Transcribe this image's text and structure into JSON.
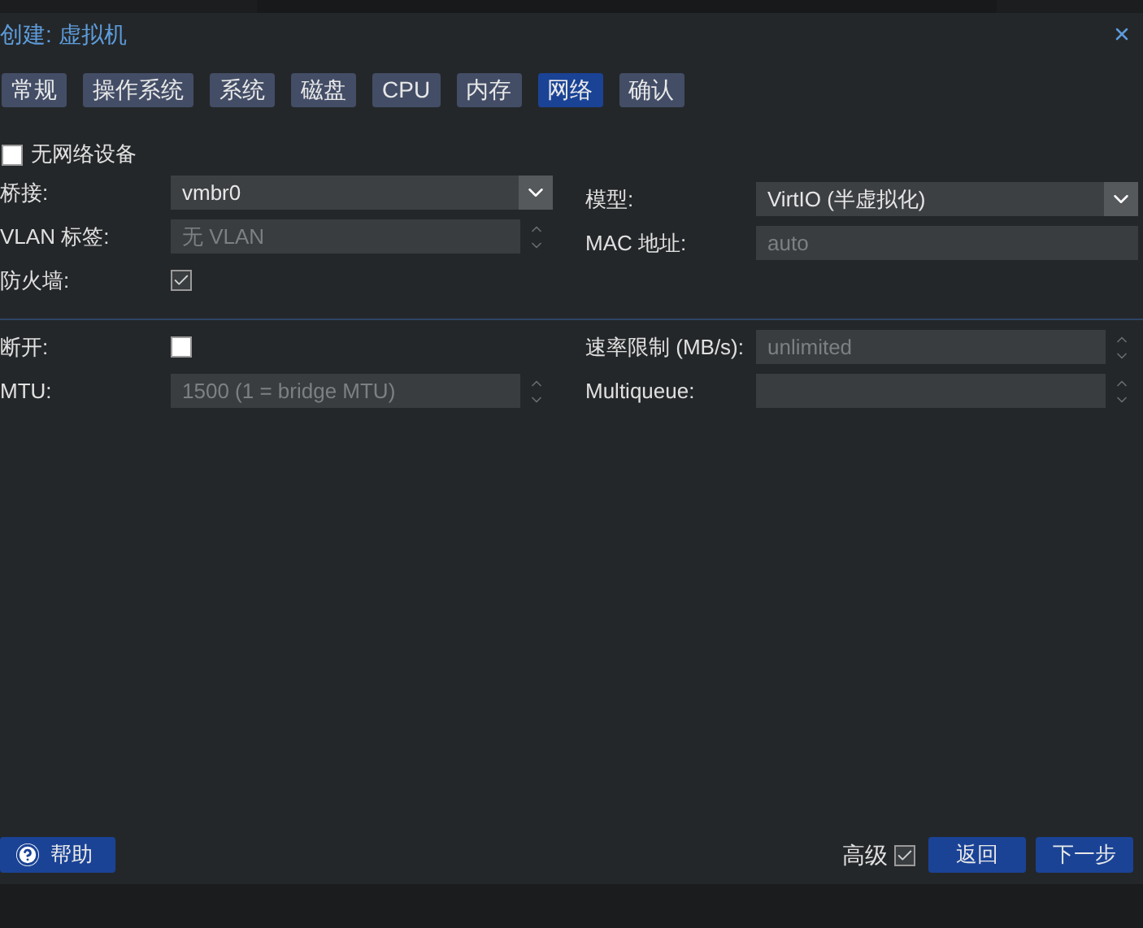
{
  "window": {
    "title": "创建: 虚拟机"
  },
  "tabs": [
    {
      "label": "常规",
      "selected": false
    },
    {
      "label": "操作系统",
      "selected": false
    },
    {
      "label": "系统",
      "selected": false
    },
    {
      "label": "磁盘",
      "selected": false
    },
    {
      "label": "CPU",
      "selected": false
    },
    {
      "label": "内存",
      "selected": false
    },
    {
      "label": "网络",
      "selected": true
    },
    {
      "label": "确认",
      "selected": false
    }
  ],
  "no_network_device": {
    "label": "无网络设备",
    "checked": false
  },
  "left_fields": [
    {
      "kind": "select",
      "label": "桥接:",
      "value": "vmbr0"
    },
    {
      "kind": "spinner",
      "label": "VLAN 标签:",
      "placeholder": "无 VLAN"
    },
    {
      "kind": "checkbox",
      "label": "防火墙:",
      "checked": true
    }
  ],
  "right_fields": [
    {
      "kind": "select",
      "label": "模型:",
      "value": "VirtIO (半虚拟化)"
    },
    {
      "kind": "text",
      "label": "MAC 地址:",
      "placeholder": "auto"
    }
  ],
  "advanced_left": [
    {
      "kind": "checkbox",
      "label": "断开:",
      "checked": false
    },
    {
      "kind": "spinner",
      "label": "MTU:",
      "placeholder": "1500 (1 = bridge MTU)"
    }
  ],
  "advanced_right": [
    {
      "kind": "spinner",
      "label": "速率限制 (MB/s):",
      "placeholder": "unlimited"
    },
    {
      "kind": "spinner",
      "label": "Multiqueue:"
    }
  ],
  "footer": {
    "help": "帮助",
    "advanced": {
      "label": "高级",
      "checked": true
    },
    "buttons": [
      "返回",
      "下一步"
    ]
  }
}
